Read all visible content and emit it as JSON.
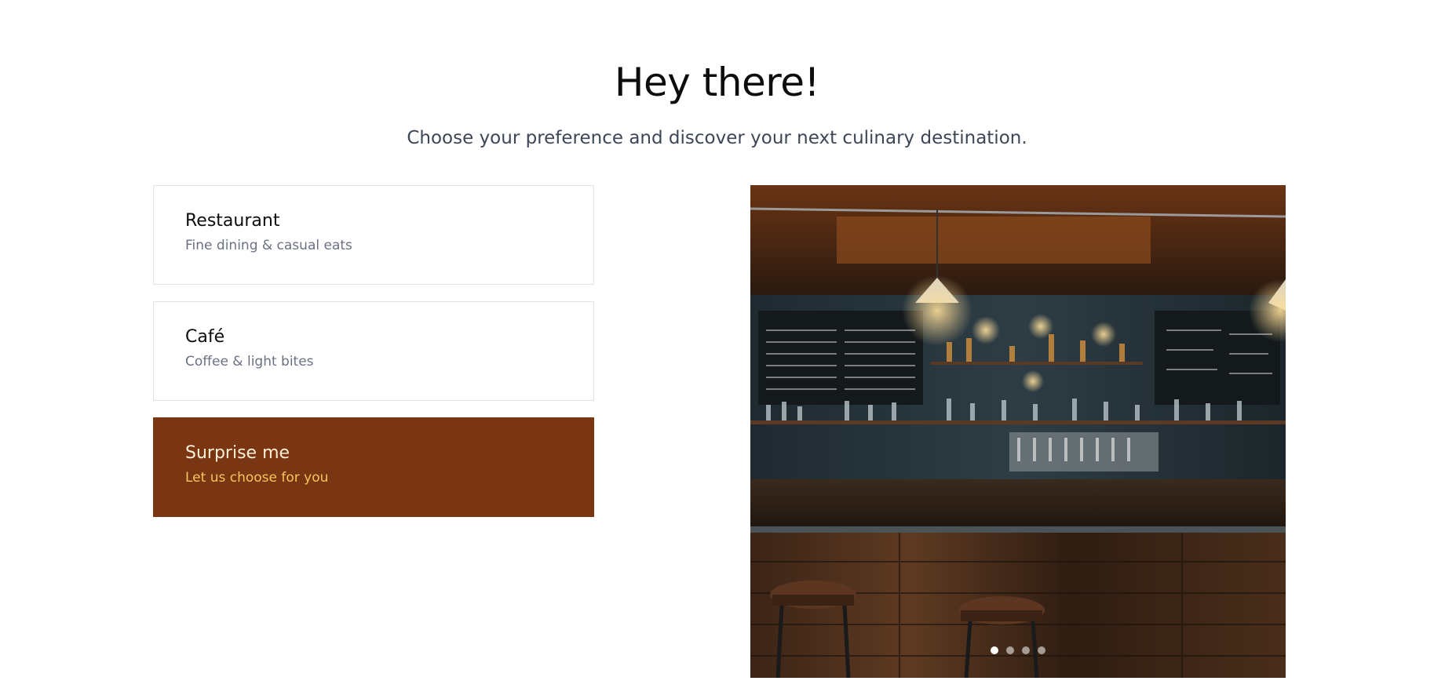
{
  "header": {
    "title": "Hey there!",
    "subtitle": "Choose your preference and discover your next culinary destination."
  },
  "options": [
    {
      "title": "Restaurant",
      "description": "Fine dining & casual eats",
      "selected": false
    },
    {
      "title": "Café",
      "description": "Coffee & light bites",
      "selected": false
    },
    {
      "title": "Surprise me",
      "description": "Let us choose for you",
      "selected": true
    }
  ],
  "carousel": {
    "image_subject": "bar-interior-photo",
    "slide_count": 4,
    "active_slide": 1
  },
  "colors": {
    "accent_bg": "#7a3513",
    "accent_title": "#fdf0d6",
    "accent_desc": "#f7c65a",
    "text_primary": "#0d0d0d",
    "text_muted": "#6b7182"
  }
}
